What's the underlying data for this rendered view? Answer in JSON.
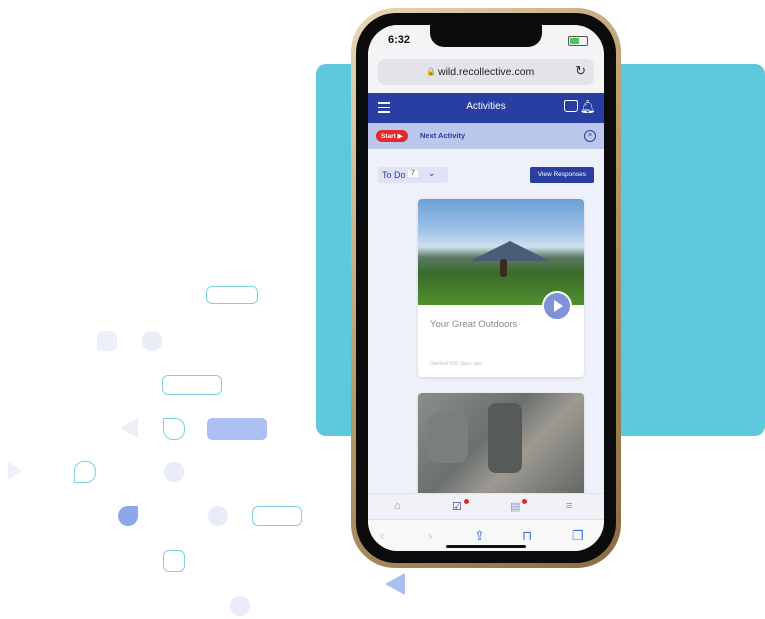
{
  "colors": {
    "teal": "#5ec8dc",
    "app_primary": "#283ea3",
    "start_red": "#e12b2b"
  },
  "status_bar": {
    "time": "6:32"
  },
  "browser": {
    "url": "wild.recollective.com",
    "lock_icon": "lock-icon",
    "reload_icon": "reload-icon"
  },
  "app_bar": {
    "title": "Activities",
    "menu_icon": "hamburger-icon",
    "inbox_icon": "inbox-icon",
    "bell_icon": "bell-icon"
  },
  "next_activity": {
    "start_label": "Start ▶",
    "label": "Next Activity"
  },
  "filter": {
    "todo_label": "To Do",
    "todo_count": "7",
    "view_responses_label": "View Responses"
  },
  "cards": [
    {
      "title": "Your Great Outdoors",
      "meta": "Started 000 days ago"
    },
    {
      "title": ""
    }
  ],
  "tab_bar": [
    "home-icon",
    "tasks-icon",
    "chat-icon",
    "list-icon"
  ],
  "safari_toolbar": [
    "back-icon",
    "forward-icon",
    "share-icon",
    "bookmarks-icon",
    "tabs-icon"
  ]
}
